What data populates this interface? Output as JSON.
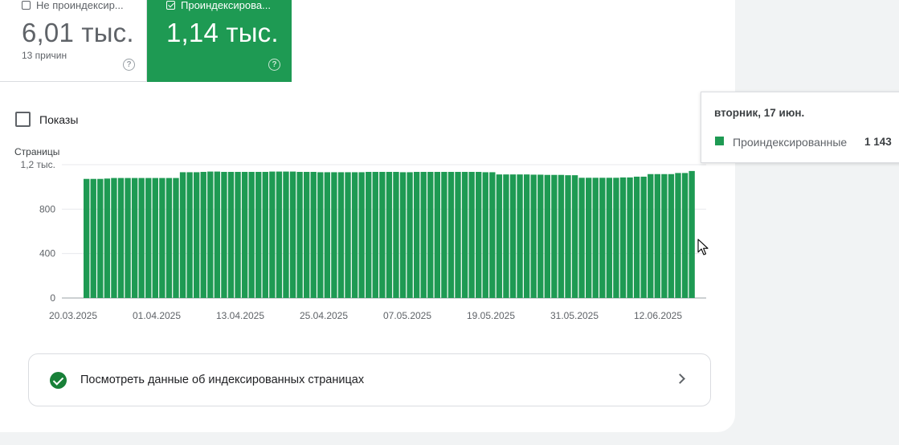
{
  "tiles": {
    "not_indexed": {
      "label": "Не проиндексир...",
      "value": "6,01 тыс.",
      "sub": "13 причин",
      "help": "?"
    },
    "indexed": {
      "label": "Проиндексирова...",
      "value": "1,14 тыс.",
      "help": "?",
      "color": "#1e9a53"
    }
  },
  "impressions": {
    "label": "Показы"
  },
  "chart_data": {
    "type": "bar",
    "ylabel": "Страницы",
    "y_tick_labels": [
      "0",
      "400",
      "800",
      "1,2 тыс."
    ],
    "y_ticks": [
      0,
      400,
      800,
      1200
    ],
    "ylim": [
      0,
      1200
    ],
    "x_tick_labels": [
      "20.03.2025",
      "01.04.2025",
      "13.04.2025",
      "25.04.2025",
      "07.05.2025",
      "19.05.2025",
      "31.05.2025",
      "12.06.2025"
    ],
    "x_start": "2025-03-20",
    "x_end": "2025-06-17",
    "grid": true,
    "color": "#1e9a53",
    "series": [
      {
        "name": "Проиндексированные",
        "values": [
          1072,
          1072,
          1072,
          1075,
          1080,
          1080,
          1080,
          1080,
          1080,
          1080,
          1080,
          1080,
          1080,
          1080,
          1132,
          1132,
          1132,
          1135,
          1138,
          1138,
          1135,
          1135,
          1135,
          1135,
          1135,
          1135,
          1135,
          1138,
          1138,
          1138,
          1138,
          1135,
          1135,
          1135,
          1132,
          1132,
          1132,
          1132,
          1132,
          1132,
          1132,
          1135,
          1135,
          1135,
          1135,
          1135,
          1132,
          1132,
          1135,
          1135,
          1135,
          1135,
          1135,
          1135,
          1135,
          1135,
          1135,
          1135,
          1132,
          1132,
          1112,
          1112,
          1112,
          1112,
          1112,
          1110,
          1110,
          1108,
          1108,
          1108,
          1105,
          1105,
          1082,
          1082,
          1082,
          1082,
          1082,
          1082,
          1085,
          1085,
          1092,
          1092,
          1115,
          1115,
          1115,
          1115,
          1125,
          1125,
          1143
        ]
      }
    ]
  },
  "link": {
    "text": "Посмотреть данные об индексированных страницах"
  },
  "tooltip": {
    "date": "вторник, 17 июн.",
    "series": "Проиндексированные",
    "value": "1 143"
  }
}
